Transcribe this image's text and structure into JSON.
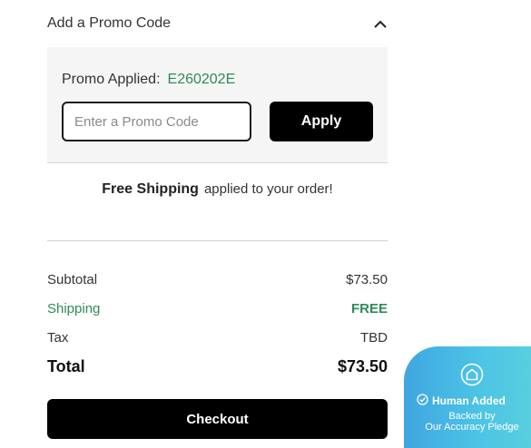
{
  "promo": {
    "header_title": "Add a Promo Code",
    "applied_label": "Promo Applied:",
    "applied_code": "E260202E",
    "input_value": "",
    "input_placeholder": "Enter a Promo Code",
    "apply_label": "Apply"
  },
  "shipping_message": {
    "bold": "Free Shipping",
    "rest": "applied to your order!"
  },
  "summary": {
    "subtotal_label": "Subtotal",
    "subtotal_value": "$73.50",
    "shipping_label": "Shipping",
    "shipping_value": "FREE",
    "tax_label": "Tax",
    "tax_value": "TBD",
    "total_label": "Total",
    "total_value": "$73.50"
  },
  "checkout_label": "Checkout",
  "pledge": {
    "icon": "house-shield-icon",
    "headline": "Human Added",
    "line1": "Backed by",
    "line2": "Our Accuracy Pledge"
  },
  "colors": {
    "accent_green": "#2e8b57",
    "button_black": "#000000",
    "badge_blue": "#4cc4e6"
  }
}
